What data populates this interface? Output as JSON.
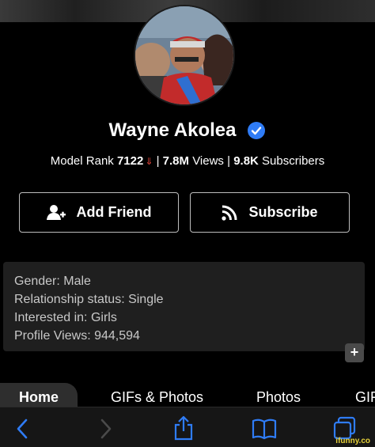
{
  "profile": {
    "name": "Wayne Akolea",
    "verified_icon": "verified-check-icon",
    "rank_label": "Model Rank",
    "rank_value": "7122",
    "rank_icon": "rank-down-chevron-icon",
    "views_value": "7.8M",
    "views_label": "Views",
    "subscribers_value": "9.8K",
    "subscribers_label": "Subscribers",
    "separator": "|"
  },
  "actions": {
    "add_friend_label": "Add Friend",
    "add_friend_icon": "add-user-icon",
    "subscribe_label": "Subscribe",
    "subscribe_icon": "rss-feed-icon"
  },
  "info": {
    "lines": [
      "Gender: Male",
      "Relationship status: Single",
      "Interested in: Girls",
      "Profile Views: 944,594"
    ],
    "expand_label": "+"
  },
  "tabs": [
    "Home",
    "GIFs & Photos",
    "Photos",
    "GIF"
  ],
  "toolbar": {
    "icons": [
      "back-chevron-icon",
      "forward-chevron-icon",
      "share-icon",
      "bookmarks-book-icon",
      "tabs-icon"
    ]
  },
  "watermark": "ifunny.co",
  "colors": {
    "accent_blue": "#2f7cf6",
    "rank_red": "#e0443a",
    "watermark_yellow": "#e7d23a"
  }
}
